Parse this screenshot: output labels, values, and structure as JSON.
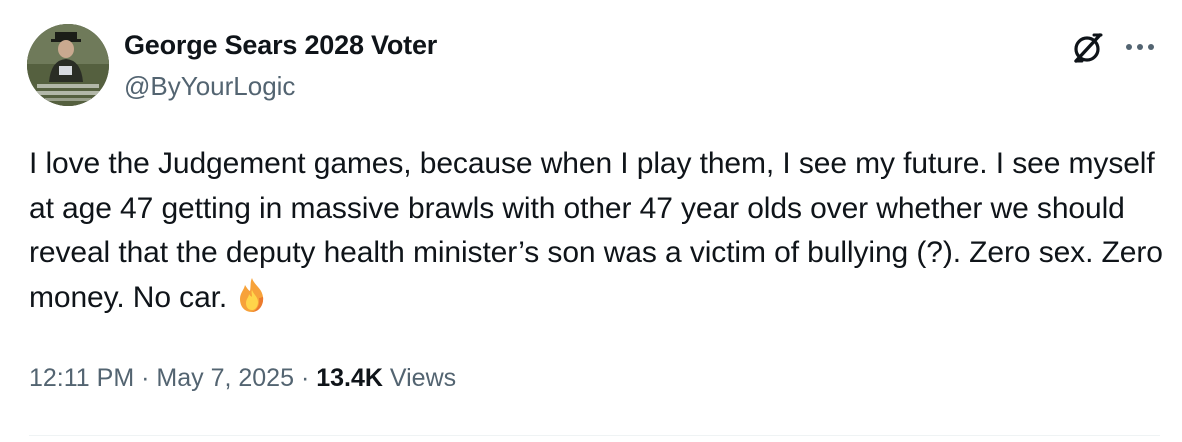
{
  "author": {
    "display_name": "George Sears 2028 Voter",
    "handle": "@ByYourLogic"
  },
  "tweet": {
    "text": "I love the Judgement games, because when I play them, I see my future. I see myself at age 47 getting in massive brawls with other 47 year olds over whether we should reveal that the deputy health minister’s son was a victim of bullying (?). Zero sex. Zero money. No car.",
    "emoji": "fire-emoji"
  },
  "meta": {
    "time": "12:11 PM",
    "separator": "·",
    "date": "May 7, 2025",
    "views_count": "13.4K",
    "views_label": "Views"
  },
  "icons": {
    "grok": "grok-icon",
    "more": "more-icon"
  },
  "colors": {
    "text_primary": "#0f1419",
    "text_secondary": "#536471",
    "divider": "#eff3f4"
  }
}
